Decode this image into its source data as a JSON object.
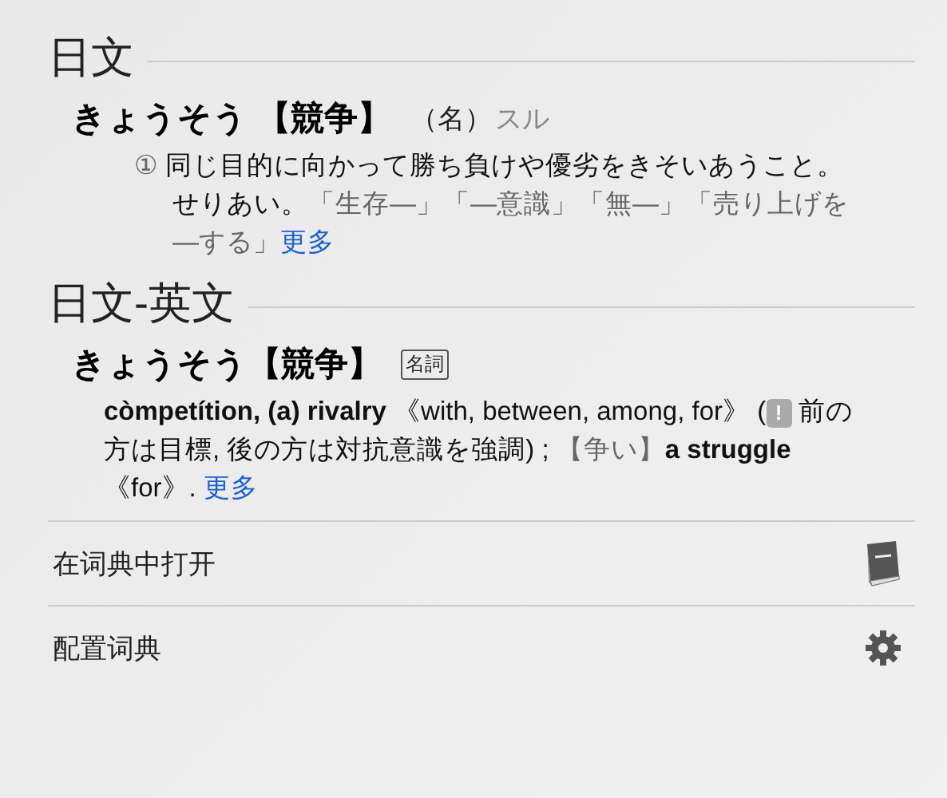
{
  "sections": [
    {
      "title": "日文",
      "entries": [
        {
          "headword": "きょうそう 【競争】",
          "pos": "（名）",
          "extra": "スル",
          "body": [
            {
              "kind": "marker",
              "text": "①"
            },
            {
              "kind": "plain",
              "text": " 同じ目的に向かって勝ち負けや優劣をきそいあうこと。せりあい。"
            },
            {
              "kind": "example",
              "text": "「生存—」「—意識」「無—」「売り上げを—する」"
            },
            {
              "kind": "link",
              "text": "更多"
            }
          ]
        }
      ]
    },
    {
      "title": "日文-英文",
      "entries": [
        {
          "headword": "きょうそう【競争】",
          "tag": "名詞",
          "body": [
            {
              "kind": "bold",
              "text": "còmpetítion, (a) rivalry"
            },
            {
              "kind": "plain",
              "text": " 《with, between, among, for》 ("
            },
            {
              "kind": "note-icon",
              "text": "!"
            },
            {
              "kind": "plain",
              "text": " 前の方は目標, 後の方は対抗意識を強調) ; "
            },
            {
              "kind": "example",
              "text": "【争い】"
            },
            {
              "kind": "bold",
              "text": "a struggle"
            },
            {
              "kind": "plain",
              "text": " 《for》. "
            },
            {
              "kind": "link",
              "text": "更多"
            }
          ]
        }
      ]
    }
  ],
  "actions": [
    {
      "label": "在词典中打开",
      "kind": "book"
    },
    {
      "label": "配置词典",
      "kind": "gear"
    }
  ]
}
